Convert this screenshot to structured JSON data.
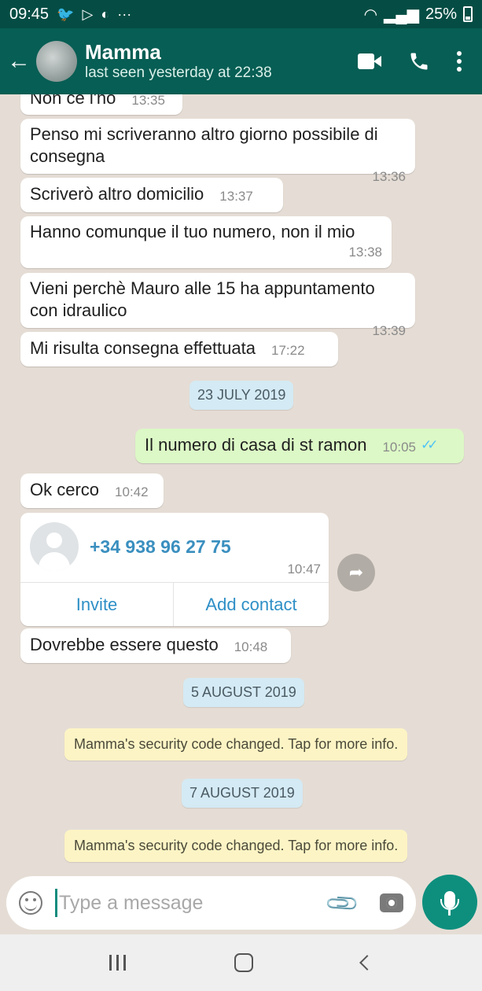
{
  "status_bar": {
    "time": "09:45",
    "battery": "25%",
    "more": "···"
  },
  "header": {
    "back_glyph": "←",
    "contact_name": "Mamma",
    "last_seen": "last seen yesterday at 22:38"
  },
  "messages": [
    {
      "text": "Non ce l'ho",
      "time": "13:35"
    },
    {
      "text": "Penso mi scriveranno altro giorno possibile di consegna",
      "time": "13:36"
    },
    {
      "text": "Scriverò altro domicilio",
      "time": "13:37"
    },
    {
      "text": "Hanno comunque il tuo numero, non il mio",
      "time": "13:38"
    },
    {
      "text": "Vieni perchè Mauro alle 15 ha appuntamento con idraulico",
      "time": "13:39"
    },
    {
      "text": "Mi risulta consegna effettuata",
      "time": "17:22"
    },
    {
      "text": "Il numero di casa di st ramon",
      "time": "10:05"
    },
    {
      "text": "Ok cerco",
      "time": "10:42"
    },
    {
      "text": "Dovrebbe essere questo",
      "time": "10:48"
    }
  ],
  "dates": [
    "23 JULY 2019",
    "5 AUGUST 2019",
    "7 AUGUST 2019"
  ],
  "system_notices": [
    "Mamma's security code changed. Tap for more info.",
    "Mamma's security code changed. Tap for more info."
  ],
  "contact_card": {
    "phone": "+34 938 96 27 75",
    "time": "10:47",
    "invite_label": "Invite",
    "add_contact_label": "Add contact"
  },
  "composer": {
    "placeholder": "Type a message"
  },
  "colors": {
    "header": "#075e54",
    "statusbar": "#054d44",
    "outgoing": "#dcf8c6",
    "accent": "#0e8f7e"
  }
}
